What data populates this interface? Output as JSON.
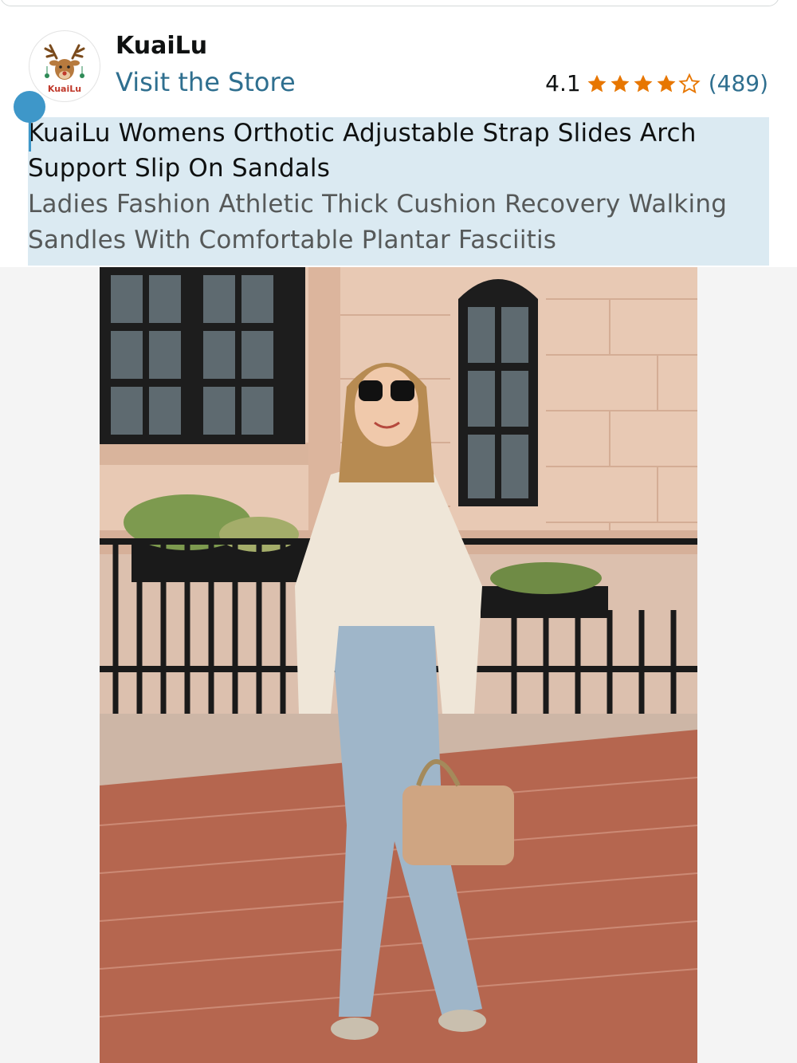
{
  "store": {
    "name": "KuaiLu",
    "logo_text": "KuaiLu",
    "visit_label": "Visit the Store",
    "rating": "4.1",
    "stars_filled": 4,
    "stars_total": 5,
    "review_count": "(489)",
    "star_color": "#e77600"
  },
  "product": {
    "title_lines": [
      "KuaiLu Womens Orthotic Adjustable Strap Slides Arch",
      "Support Slip On Sandals"
    ],
    "subtitle_lines": [
      "Ladies Fashion Athletic Thick Cushion Recovery Walking",
      "Sandles With Comfortable Plantar Fasciitis"
    ],
    "selection_color": "#dbeaf2",
    "selection_handle_color": "#3e97c9"
  },
  "image": {
    "alt": "Woman in cream blouse, light jeans and slide sandals holding a tan bag on a brick sidewalk"
  }
}
